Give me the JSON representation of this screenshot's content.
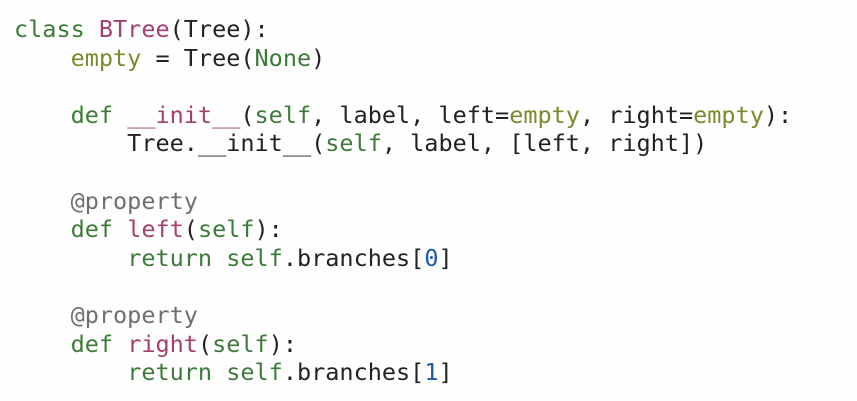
{
  "code": {
    "lines": [
      [
        {
          "text": "class ",
          "style": "keyword"
        },
        {
          "text": "BTree",
          "style": "name"
        },
        {
          "text": "(Tree):",
          "style": "default"
        }
      ],
      [
        {
          "text": "    ",
          "style": "default"
        },
        {
          "text": "empty",
          "style": "constant"
        },
        {
          "text": " = Tree(",
          "style": "default"
        },
        {
          "text": "None",
          "style": "keyword"
        },
        {
          "text": ")",
          "style": "default"
        }
      ],
      [],
      [
        {
          "text": "    ",
          "style": "default"
        },
        {
          "text": "def ",
          "style": "keyword"
        },
        {
          "text": "__init__",
          "style": "name"
        },
        {
          "text": "(",
          "style": "default"
        },
        {
          "text": "self",
          "style": "keyword"
        },
        {
          "text": ", label, left=",
          "style": "default"
        },
        {
          "text": "empty",
          "style": "constant"
        },
        {
          "text": ", right=",
          "style": "default"
        },
        {
          "text": "empty",
          "style": "constant"
        },
        {
          "text": "):",
          "style": "default"
        }
      ],
      [
        {
          "text": "        Tree.__init__(",
          "style": "default"
        },
        {
          "text": "self",
          "style": "keyword"
        },
        {
          "text": ", label, [left, right])",
          "style": "default"
        }
      ],
      [],
      [
        {
          "text": "    ",
          "style": "default"
        },
        {
          "text": "@property",
          "style": "decorator"
        }
      ],
      [
        {
          "text": "    ",
          "style": "default"
        },
        {
          "text": "def ",
          "style": "keyword"
        },
        {
          "text": "left",
          "style": "name"
        },
        {
          "text": "(",
          "style": "default"
        },
        {
          "text": "self",
          "style": "keyword"
        },
        {
          "text": "):",
          "style": "default"
        }
      ],
      [
        {
          "text": "        ",
          "style": "default"
        },
        {
          "text": "return ",
          "style": "keyword"
        },
        {
          "text": "self",
          "style": "keyword"
        },
        {
          "text": ".branches[",
          "style": "default"
        },
        {
          "text": "0",
          "style": "number"
        },
        {
          "text": "]",
          "style": "default"
        }
      ],
      [],
      [
        {
          "text": "    ",
          "style": "default"
        },
        {
          "text": "@property",
          "style": "decorator"
        }
      ],
      [
        {
          "text": "    ",
          "style": "default"
        },
        {
          "text": "def ",
          "style": "keyword"
        },
        {
          "text": "right",
          "style": "name"
        },
        {
          "text": "(",
          "style": "default"
        },
        {
          "text": "self",
          "style": "keyword"
        },
        {
          "text": "):",
          "style": "default"
        }
      ],
      [
        {
          "text": "        ",
          "style": "default"
        },
        {
          "text": "return ",
          "style": "keyword"
        },
        {
          "text": "self",
          "style": "keyword"
        },
        {
          "text": ".branches[",
          "style": "default"
        },
        {
          "text": "1",
          "style": "number"
        },
        {
          "text": "]",
          "style": "default"
        }
      ]
    ]
  }
}
